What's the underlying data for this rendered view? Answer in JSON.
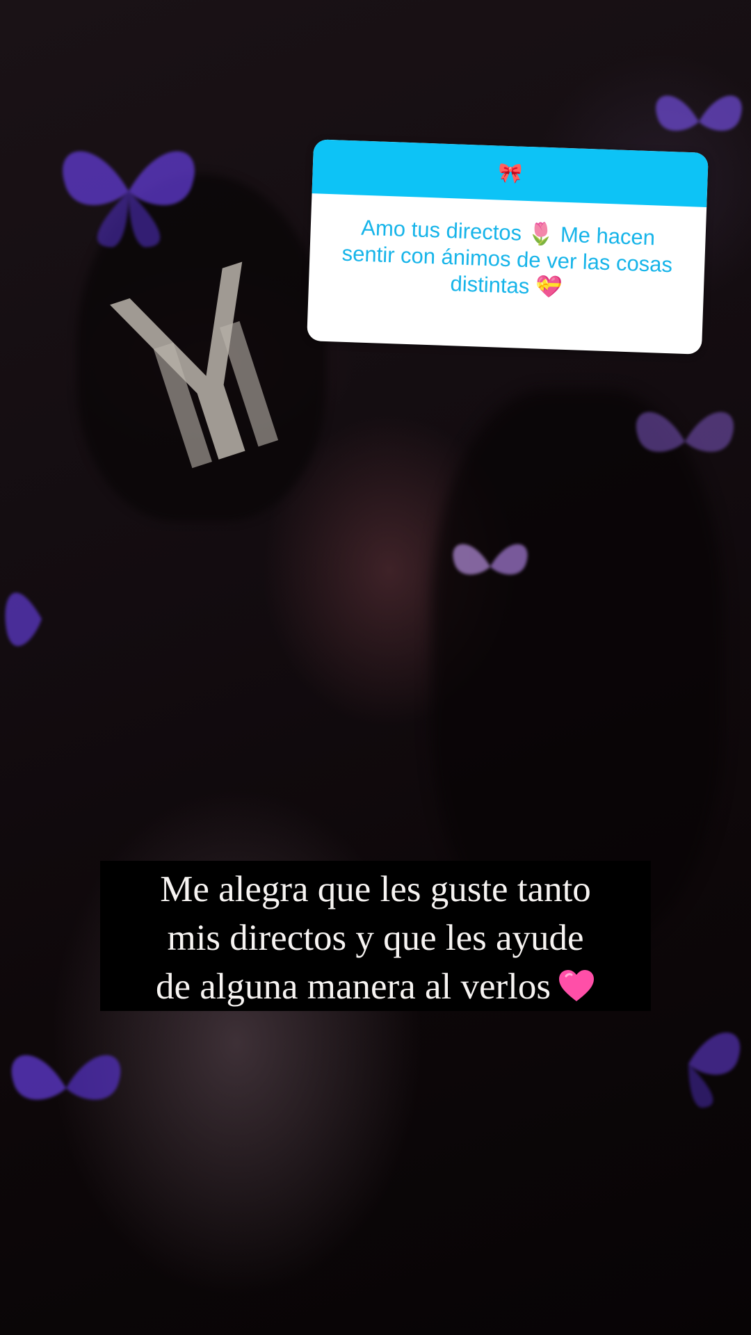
{
  "question_sticker": {
    "header_icon": "ribbon-bow-icon",
    "header_emoji": "🎀",
    "question_text": "Amo tus directos 🌷 Me hacen sentir con ánimos de ver las cosas distintas 💝"
  },
  "reply_caption": {
    "line1": "Me alegra que les guste tanto",
    "line2": "mis directos y que les ayude",
    "line3": "de alguna manera al verlos",
    "trailing_icon": "pink-heart-icon"
  },
  "colors": {
    "sticker_header": "#0dc3f6",
    "sticker_text": "#16b4e9",
    "caption_background": "#000000",
    "caption_text": "#f7f4f2",
    "heart": "#ff4fa8",
    "butterfly": "#7a4dff"
  }
}
